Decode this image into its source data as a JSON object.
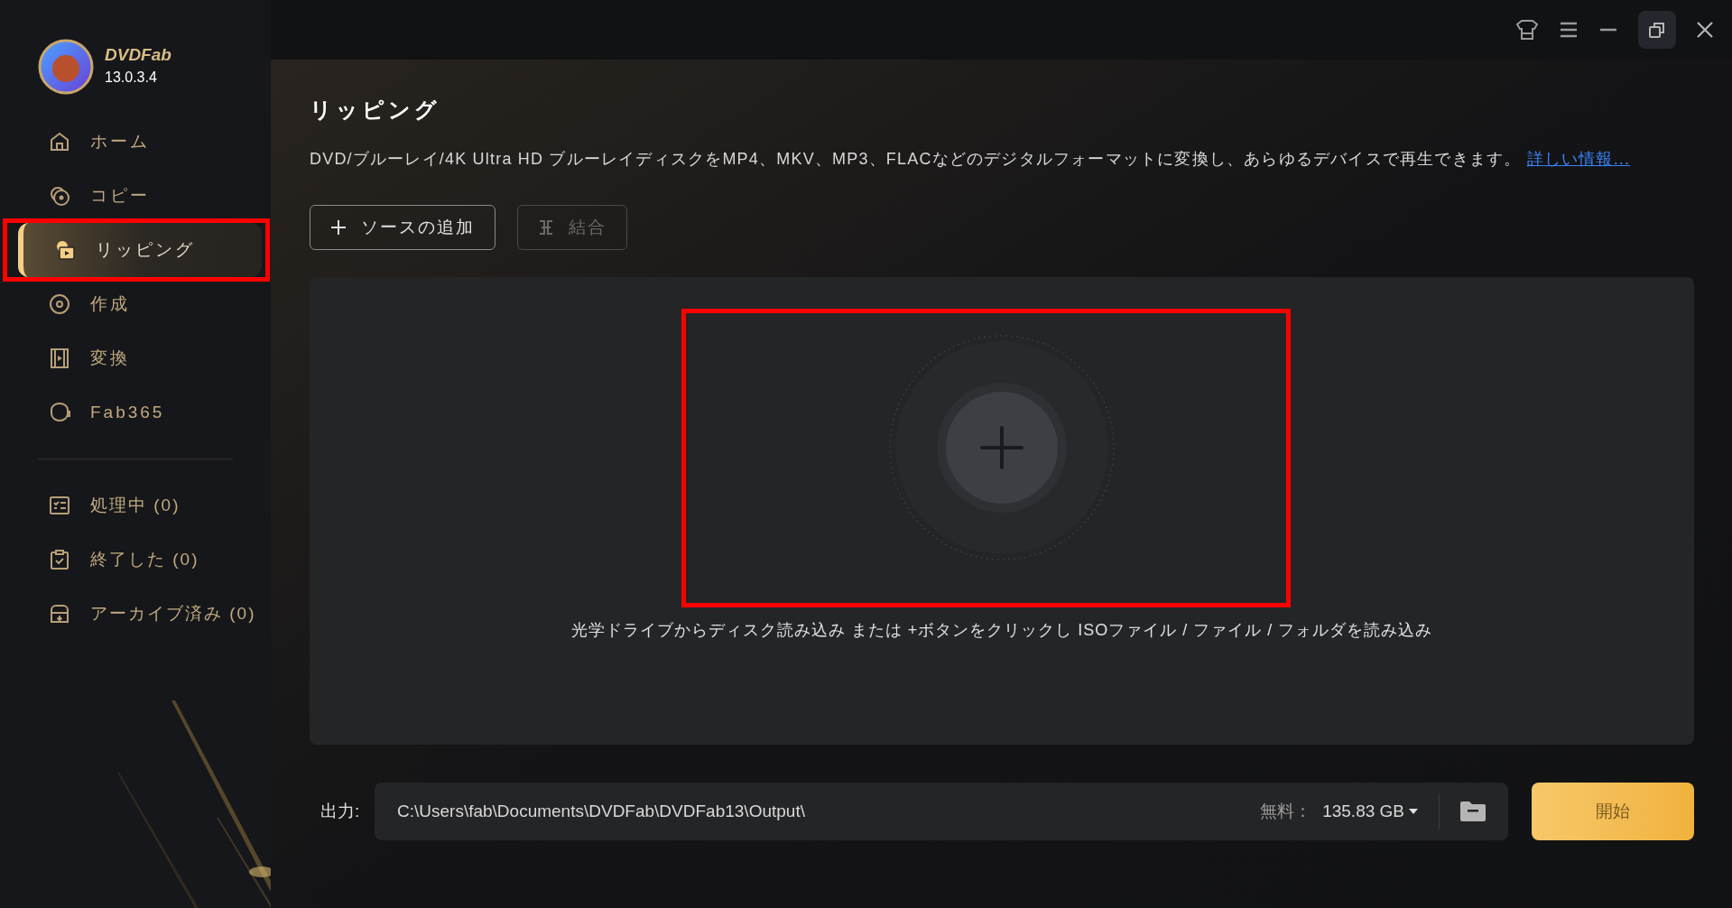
{
  "sidebar": {
    "brand": "DVDFab",
    "version": "13.0.3.4",
    "nav": [
      {
        "label": "ホーム",
        "selected": false,
        "highlighted": false
      },
      {
        "label": "コピー",
        "selected": false,
        "highlighted": false
      },
      {
        "label": "リッピング",
        "selected": true,
        "highlighted": true
      },
      {
        "label": "作成",
        "selected": false,
        "highlighted": false
      },
      {
        "label": "変換",
        "selected": false,
        "highlighted": false
      },
      {
        "label": "Fab365",
        "selected": false,
        "highlighted": false
      }
    ],
    "queue": [
      {
        "label": "処理中 (0)"
      },
      {
        "label": "終了した (0)"
      },
      {
        "label": "アーカイブ済み (0)"
      }
    ]
  },
  "main": {
    "title": "リッピング",
    "description": "DVD/ブルーレイ/4K Ultra HD ブルーレイディスクをMP4、MKV、MP3、FLACなどのデジタルフォーマットに変換し、あらゆるデバイスで再生できます。",
    "link": "詳しい情報...",
    "buttons": [
      {
        "label": "ソースの追加",
        "disabled": false
      },
      {
        "label": "結合",
        "disabled": true
      }
    ],
    "drop_zone": {
      "highlighted": true,
      "hint": "光学ドライブからディスク読み込み または +ボタンをクリックし ISOファイル / ファイル / フォルダを読み込み"
    },
    "output": {
      "label": "出力:",
      "path": "C:\\Users\\fab\\Documents\\DVDFab\\DVDFab13\\Output\\",
      "free_label": "無料：",
      "free_value": "135.83 GB"
    },
    "start_button": "開始"
  }
}
